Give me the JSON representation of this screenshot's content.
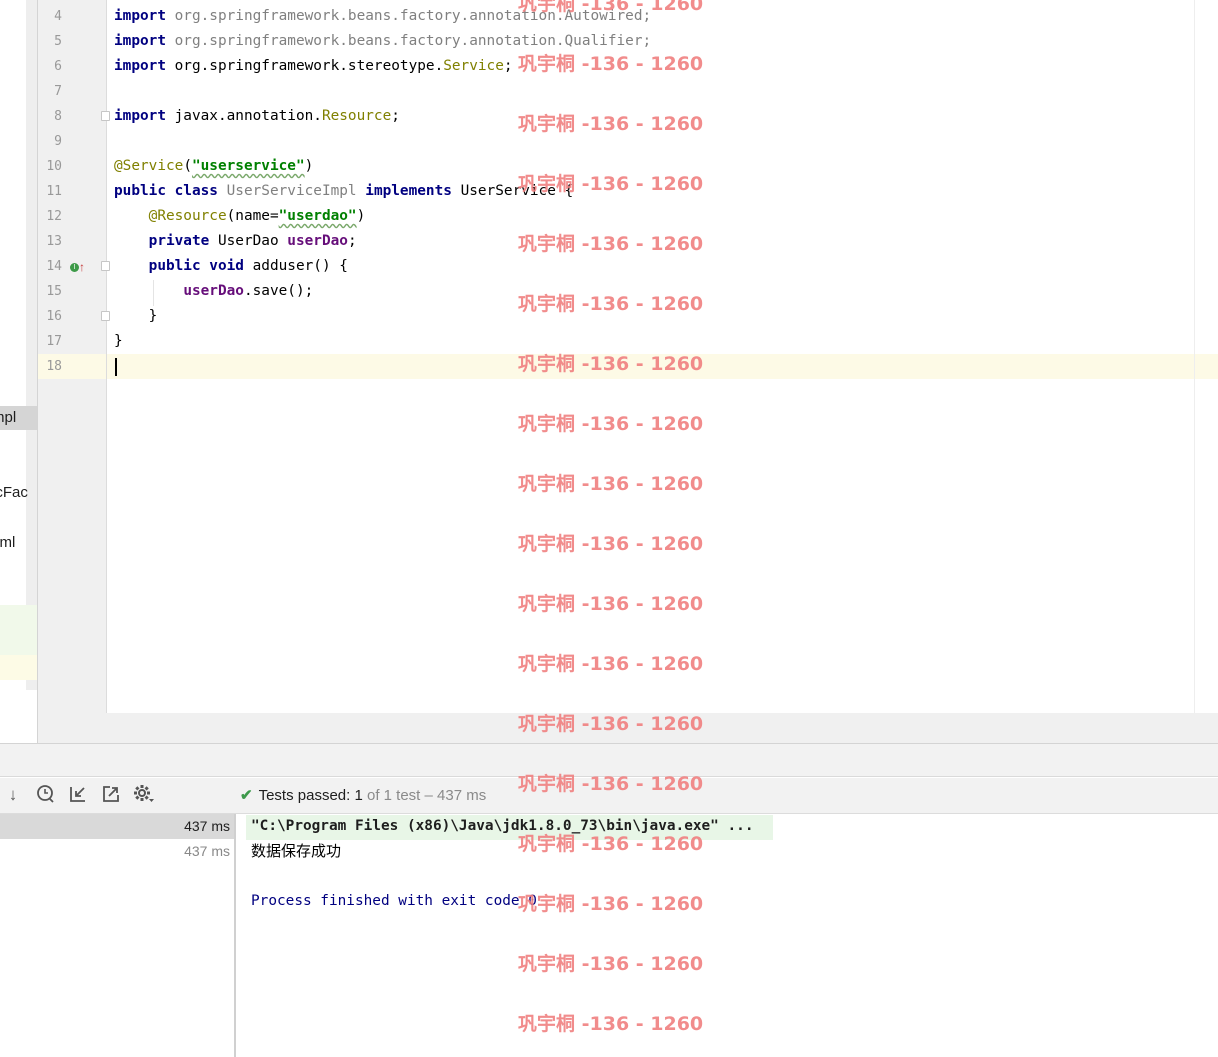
{
  "project_tree": {
    "items": [
      "mpl",
      "icFac",
      "xml"
    ]
  },
  "editor": {
    "lines": [
      {
        "num": "4",
        "tokens": [
          {
            "t": "import",
            "c": "kw"
          },
          {
            "t": " org.springframework.beans.factory.annotation.Autowired;",
            "c": "gray"
          }
        ]
      },
      {
        "num": "5",
        "tokens": [
          {
            "t": "import",
            "c": "kw"
          },
          {
            "t": " org.springframework.beans.factory.annotation.Qualifier;",
            "c": "gray"
          }
        ]
      },
      {
        "num": "6",
        "tokens": [
          {
            "t": "import",
            "c": "kw"
          },
          {
            "t": " org.springframework.stereotype.",
            "c": ""
          },
          {
            "t": "Service",
            "c": "ann"
          },
          {
            "t": ";",
            "c": ""
          }
        ]
      },
      {
        "num": "7",
        "tokens": []
      },
      {
        "num": "8",
        "tokens": [
          {
            "t": "import",
            "c": "kw"
          },
          {
            "t": " javax.annotation.",
            "c": ""
          },
          {
            "t": "Resource",
            "c": "ann"
          },
          {
            "t": ";",
            "c": ""
          }
        ]
      },
      {
        "num": "9",
        "tokens": []
      },
      {
        "num": "10",
        "tokens": [
          {
            "t": "@Service",
            "c": "ann"
          },
          {
            "t": "(",
            "c": ""
          },
          {
            "t": "\"userservice\"",
            "c": "str squiggle"
          },
          {
            "t": ")",
            "c": ""
          }
        ]
      },
      {
        "num": "11",
        "tokens": [
          {
            "t": "public class",
            "c": "kw"
          },
          {
            "t": " ",
            "c": ""
          },
          {
            "t": "UserServiceImpl",
            "c": "cls-gray"
          },
          {
            "t": " ",
            "c": ""
          },
          {
            "t": "implements",
            "c": "kw"
          },
          {
            "t": " UserService {",
            "c": ""
          }
        ]
      },
      {
        "num": "12",
        "tokens": [
          {
            "t": "    ",
            "c": ""
          },
          {
            "t": "@Resource",
            "c": "ann"
          },
          {
            "t": "(name=",
            "c": ""
          },
          {
            "t": "\"userdao\"",
            "c": "str squiggle"
          },
          {
            "t": ")",
            "c": ""
          }
        ]
      },
      {
        "num": "13",
        "tokens": [
          {
            "t": "    ",
            "c": ""
          },
          {
            "t": "private",
            "c": "kw"
          },
          {
            "t": " UserDao ",
            "c": ""
          },
          {
            "t": "userDao",
            "c": "fld"
          },
          {
            "t": ";",
            "c": ""
          }
        ]
      },
      {
        "num": "14",
        "tokens": [
          {
            "t": "    ",
            "c": ""
          },
          {
            "t": "public void",
            "c": "kw"
          },
          {
            "t": " adduser() {",
            "c": ""
          }
        ]
      },
      {
        "num": "15",
        "tokens": [
          {
            "t": "        ",
            "c": ""
          },
          {
            "t": "userDao",
            "c": "fld"
          },
          {
            "t": ".save();",
            "c": ""
          }
        ]
      },
      {
        "num": "16",
        "tokens": [
          {
            "t": "    }",
            "c": ""
          }
        ]
      },
      {
        "num": "17",
        "tokens": [
          {
            "t": "}",
            "c": ""
          }
        ]
      },
      {
        "num": "18",
        "tokens": []
      }
    ]
  },
  "run_panel": {
    "status_prefix": "Tests passed: ",
    "status_count": "1",
    "status_suffix": " of 1 test – 437 ms",
    "tree_durations": [
      "437 ms",
      "437 ms"
    ],
    "console_cmd": "\"C:\\Program Files (x86)\\Java\\jdk1.8.0_73\\bin\\java.exe\" ...",
    "console_output": "数据保存成功",
    "console_exit": "Process finished with exit code 0"
  },
  "toolbar_icons": [
    "arrow-down-icon",
    "history-clock-icon",
    "import-tests-icon",
    "export-tests-icon",
    "settings-gear-icon"
  ],
  "watermark": "巩宇桐 -136 - 1260",
  "colors": {
    "keyword": "#000080",
    "annotation": "#808000",
    "string": "#008000",
    "field": "#660e7a",
    "watermark": "#f08080",
    "test_pass": "#3e9a4c"
  }
}
